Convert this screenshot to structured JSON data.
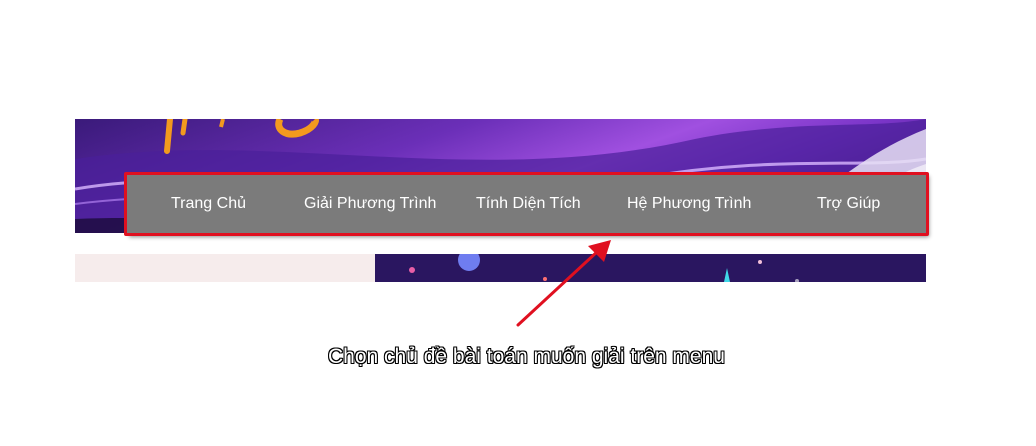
{
  "menu": {
    "items": [
      {
        "label": "Trang Chủ"
      },
      {
        "label": "Giải Phương Trình"
      },
      {
        "label": "Tính Diện Tích"
      },
      {
        "label": "Hệ Phương Trình"
      },
      {
        "label": "Trợ Giúp"
      }
    ]
  },
  "annotation": {
    "caption": "Chọn chủ đề bài toán muốn giải trên menu",
    "highlight_color": "#e01020",
    "arrow_color": "#e01020"
  },
  "colors": {
    "menu_bg": "#7b7b7b",
    "banner_purple": "#6b2fb8",
    "logo_orange": "#f39a1e"
  }
}
